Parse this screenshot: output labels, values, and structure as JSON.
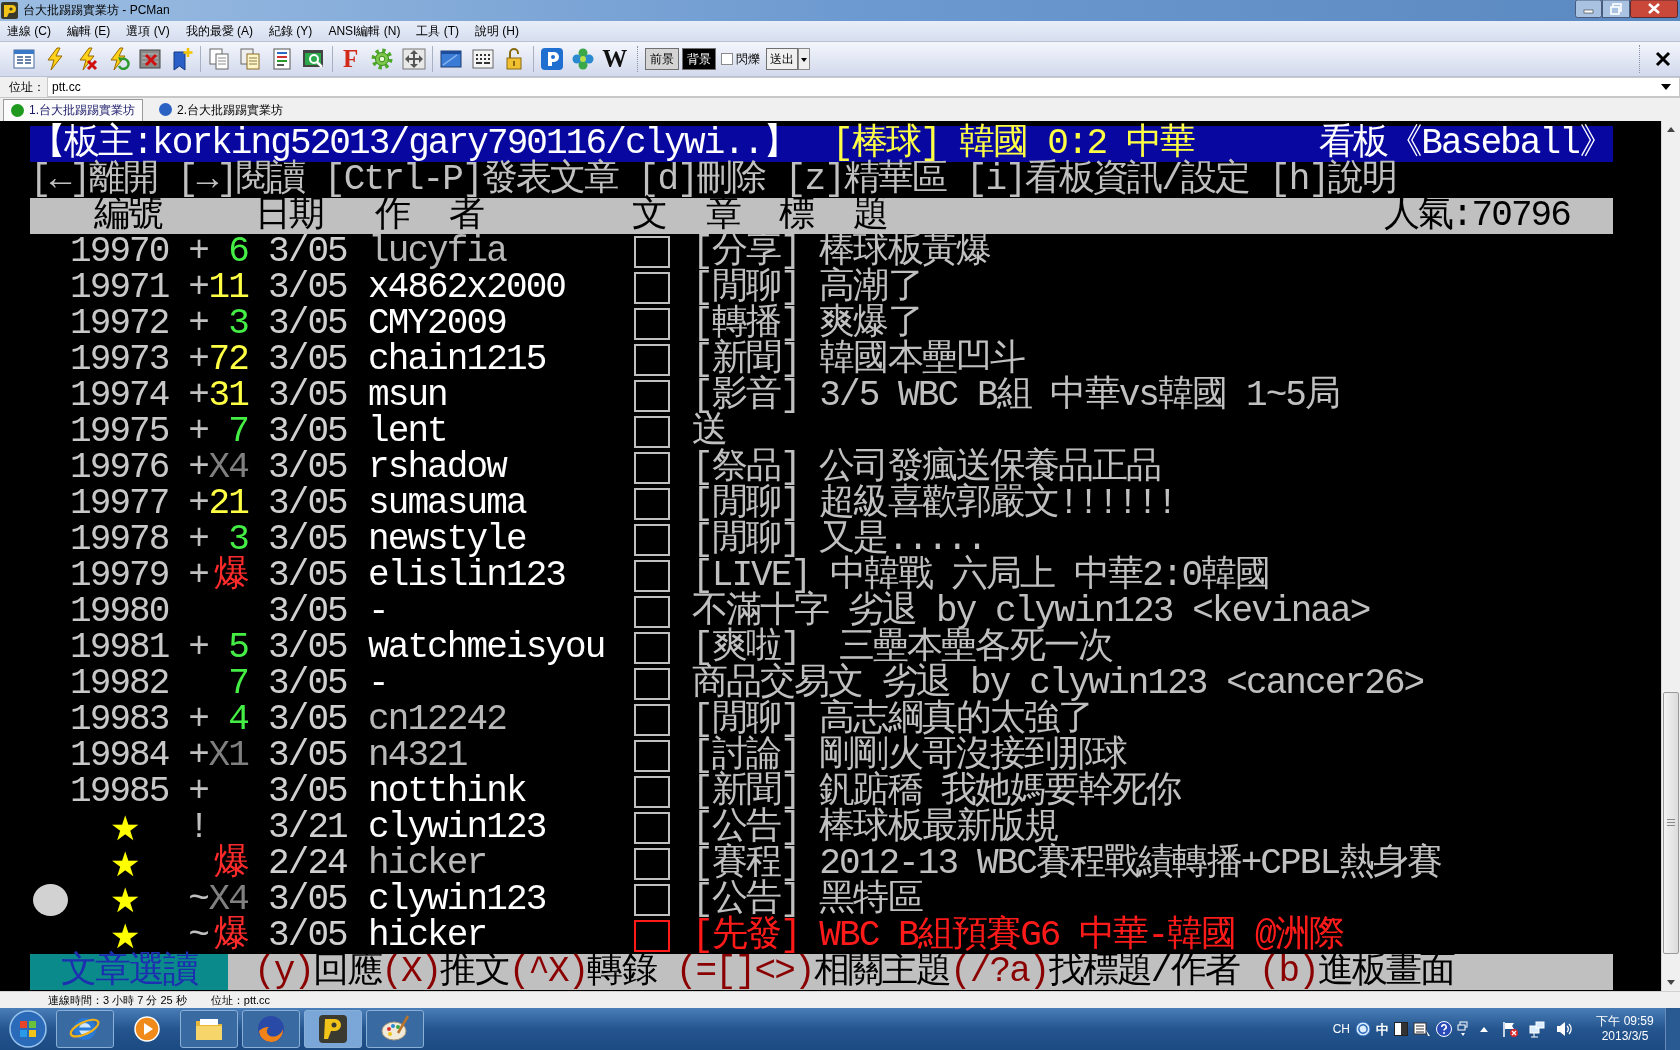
{
  "window": {
    "title": "台大批踢踢實業坊 - PCMan"
  },
  "menu": [
    "連線 (C)",
    "編輯 (E)",
    "選項 (V)",
    "我的最愛 (A)",
    "紀錄 (Y)",
    "ANSI編輯 (N)",
    "工具 (T)",
    "說明 (H)"
  ],
  "toolbar": {
    "letter_buttons": [
      {
        "text": "F",
        "color": "#d42a1a"
      },
      {
        "text": "W",
        "color": "#111111"
      }
    ],
    "color_buttons": [
      {
        "label": "前景",
        "color": "#d4d4d4"
      },
      {
        "label": "背景",
        "color": "#000000"
      }
    ],
    "blink_checkbox": {
      "label": "閃爍",
      "checked": false
    },
    "send_button": "送出"
  },
  "address": {
    "label": "位址：",
    "value": "ptt.cc"
  },
  "tabs": [
    {
      "label": "1.台大批踢踢實業坊",
      "selected": true,
      "color": "#1f9a1f"
    },
    {
      "label": "2.台大批踢踢實業坊",
      "selected": false,
      "color": "#2a62c4"
    }
  ],
  "terminal": {
    "board_bar": {
      "moderators": "【板主:korking52013/gary790116/clywi..】",
      "topic": "[棒球] 韓國 0:2 中華",
      "board": "看板《Baseball》"
    },
    "commands": "[←]離開 [→]閱讀 [Ctrl-P]發表文章 [d]刪除 [z]精華區 [i]看板資訊/設定 [h]說明",
    "columns": [
      "編號",
      "日期",
      "作  者",
      "文  章  標  題"
    ],
    "popularity": "人氣:70796",
    "rows": [
      {
        "kind": "post",
        "selected": false,
        "number": "19970",
        "mark": "+",
        "push": {
          "text": "6",
          "color": "#44ee44"
        },
        "date": "3/05",
        "author": "lucyfia",
        "author_dim": true,
        "title": {
          "text": "[分享] 棒球板黃爆",
          "color": "#c0c0c0"
        }
      },
      {
        "kind": "post",
        "selected": false,
        "number": "19971",
        "mark": "+",
        "push": {
          "text": "11",
          "color": "#ffff44"
        },
        "date": "3/05",
        "author": "x4862x2000",
        "author_dim": false,
        "title": {
          "text": "[閒聊] 高潮了",
          "color": "#c0c0c0"
        }
      },
      {
        "kind": "post",
        "selected": false,
        "number": "19972",
        "mark": "+",
        "push": {
          "text": "3",
          "color": "#44ee44"
        },
        "date": "3/05",
        "author": "CMY2009",
        "author_dim": false,
        "title": {
          "text": "[轉播] 爽爆了",
          "color": "#c0c0c0"
        }
      },
      {
        "kind": "post",
        "selected": false,
        "number": "19973",
        "mark": "+",
        "push": {
          "text": "72",
          "color": "#ffff44"
        },
        "date": "3/05",
        "author": "chain1215",
        "author_dim": false,
        "title": {
          "text": "[新聞] 韓國本壘凹斗",
          "color": "#c0c0c0"
        }
      },
      {
        "kind": "post",
        "selected": false,
        "number": "19974",
        "mark": "+",
        "push": {
          "text": "31",
          "color": "#ffff44"
        },
        "date": "3/05",
        "author": "msun",
        "author_dim": false,
        "title": {
          "text": "[影音] 3/5 WBC B組 中華vs韓國 1~5局",
          "color": "#c0c0c0"
        }
      },
      {
        "kind": "post",
        "selected": false,
        "number": "19975",
        "mark": "+",
        "push": {
          "text": "7",
          "color": "#44ee44"
        },
        "date": "3/05",
        "author": "lent",
        "author_dim": false,
        "title": {
          "text": "送",
          "color": "#c0c0c0"
        }
      },
      {
        "kind": "post",
        "selected": false,
        "number": "19976",
        "mark": "+",
        "push": {
          "text": "X4",
          "color": "#808080"
        },
        "date": "3/05",
        "author": "rshadow",
        "author_dim": false,
        "title": {
          "text": "[祭品] 公司發瘋送保養品正品",
          "color": "#c0c0c0"
        }
      },
      {
        "kind": "post",
        "selected": false,
        "number": "19977",
        "mark": "+",
        "push": {
          "text": "21",
          "color": "#ffff44"
        },
        "date": "3/05",
        "author": "sumasuma",
        "author_dim": false,
        "title": {
          "text": "[閒聊] 超級喜歡郭嚴文!!!!!!",
          "color": "#c0c0c0"
        }
      },
      {
        "kind": "post",
        "selected": false,
        "number": "19978",
        "mark": "+",
        "push": {
          "text": "3",
          "color": "#44ee44"
        },
        "date": "3/05",
        "author": "newstyle",
        "author_dim": false,
        "title": {
          "text": "[閒聊] 又是.....",
          "color": "#c0c0c0"
        }
      },
      {
        "kind": "post",
        "selected": false,
        "number": "19979",
        "mark": "+",
        "push": {
          "text": "爆",
          "color": "#ff2a2a"
        },
        "date": "3/05",
        "author": "elislin123",
        "author_dim": false,
        "title": {
          "text": "[LIVE] 中韓戰 六局上 中華2:0韓國",
          "color": "#c0c0c0"
        }
      },
      {
        "kind": "post",
        "selected": false,
        "number": "19980",
        "date": "3/05",
        "author": "-",
        "author_dim": false,
        "title": {
          "text": "不滿十字 劣退 by clywin123 <kevinaa>",
          "color": "#c0c0c0"
        }
      },
      {
        "kind": "post",
        "selected": false,
        "number": "19981",
        "mark": "+",
        "push": {
          "text": "5",
          "color": "#44ee44"
        },
        "date": "3/05",
        "author": "watchmeisyou",
        "author_dim": false,
        "title": {
          "text": "[爽啦]  三壘本壘各死一次",
          "color": "#c0c0c0"
        }
      },
      {
        "kind": "post",
        "selected": false,
        "number": "19982",
        "push": {
          "text": "7",
          "color": "#44ee44"
        },
        "date": "3/05",
        "author": "-",
        "author_dim": false,
        "title": {
          "text": "商品交易文 劣退 by clywin123 <cancer26>",
          "color": "#c0c0c0"
        }
      },
      {
        "kind": "post",
        "selected": false,
        "number": "19983",
        "mark": "+",
        "push": {
          "text": "4",
          "color": "#44ee44"
        },
        "date": "3/05",
        "author": "cn12242",
        "author_dim": true,
        "title": {
          "text": "[閒聊] 高志綱真的太強了",
          "color": "#c0c0c0"
        }
      },
      {
        "kind": "post",
        "selected": false,
        "number": "19984",
        "mark": "+",
        "push": {
          "text": "X1",
          "color": "#808080"
        },
        "date": "3/05",
        "author": "n4321",
        "author_dim": true,
        "title": {
          "text": "[討論] 剛剛火哥沒接到那球",
          "color": "#c0c0c0"
        }
      },
      {
        "kind": "post",
        "selected": false,
        "number": "19985",
        "mark": "+",
        "date": "3/05",
        "author": "notthink",
        "author_dim": false,
        "title": {
          "text": "[新聞] 釩踮穚 我她媽要幹死你",
          "color": "#c0c0c0"
        }
      },
      {
        "kind": "pinned",
        "selected": false,
        "number": "★",
        "mark": "!",
        "date": "3/21",
        "author": "clywin123",
        "author_dim": false,
        "title": {
          "text": "[公告] 棒球板最新版規",
          "color": "#c0c0c0"
        }
      },
      {
        "kind": "pinned",
        "selected": false,
        "number": "★",
        "push": {
          "text": "爆",
          "color": "#ff2a2a"
        },
        "date": "2/24",
        "author": "hicker",
        "author_dim": true,
        "title": {
          "text": "[賽程] 2012-13 WBC賽程戰績轉播+CPBL熱身賽",
          "color": "#c0c0c0"
        }
      },
      {
        "kind": "pinned",
        "selected": true,
        "number": "★",
        "mark": "~",
        "push": {
          "text": "X4",
          "color": "#808080"
        },
        "date": "3/05",
        "author": "clywin123",
        "author_dim": false,
        "title": {
          "text": "[公告] 黑特區",
          "color": "#c0c0c0"
        }
      },
      {
        "kind": "pinned",
        "selected": false,
        "number": "★",
        "mark": "~",
        "push": {
          "text": "爆",
          "color": "#ff2a2a"
        },
        "date": "3/05",
        "author": "hicker",
        "author_dim": false,
        "title": {
          "text": "[先發] WBC B組預賽G6 中華-韓國 @洲際",
          "color": "#ff1a1a"
        }
      }
    ],
    "footer": {
      "mode": "文章選讀",
      "key_groups": [
        [
          {
            "key": "(y)",
            "label": "回應"
          },
          {
            "key": "(X)",
            "label": "推文"
          },
          {
            "key": "(^X)",
            "label": "轉錄"
          }
        ],
        [
          {
            "key": "(=[]<>)",
            "label": "相關主題"
          },
          {
            "key": "(/?a)",
            "label": "找標題/作者"
          }
        ],
        [
          {
            "key": "(b)",
            "label": "進板畫面"
          }
        ]
      ]
    }
  },
  "status_bar": {
    "connection_time": "連線時間：3 小時 7 分 25 秒",
    "address": "位址：ptt.cc"
  },
  "taskbar": {
    "apps": [
      {
        "running": true,
        "selected": false
      },
      {
        "running": false,
        "selected": false
      },
      {
        "running": true,
        "selected": false
      },
      {
        "running": true,
        "selected": false
      },
      {
        "running": true,
        "selected": true
      },
      {
        "running": true,
        "selected": false
      }
    ],
    "input_language": "CH",
    "ime_mode": "中",
    "time": "下午 09:59",
    "date": "2013/3/5"
  }
}
